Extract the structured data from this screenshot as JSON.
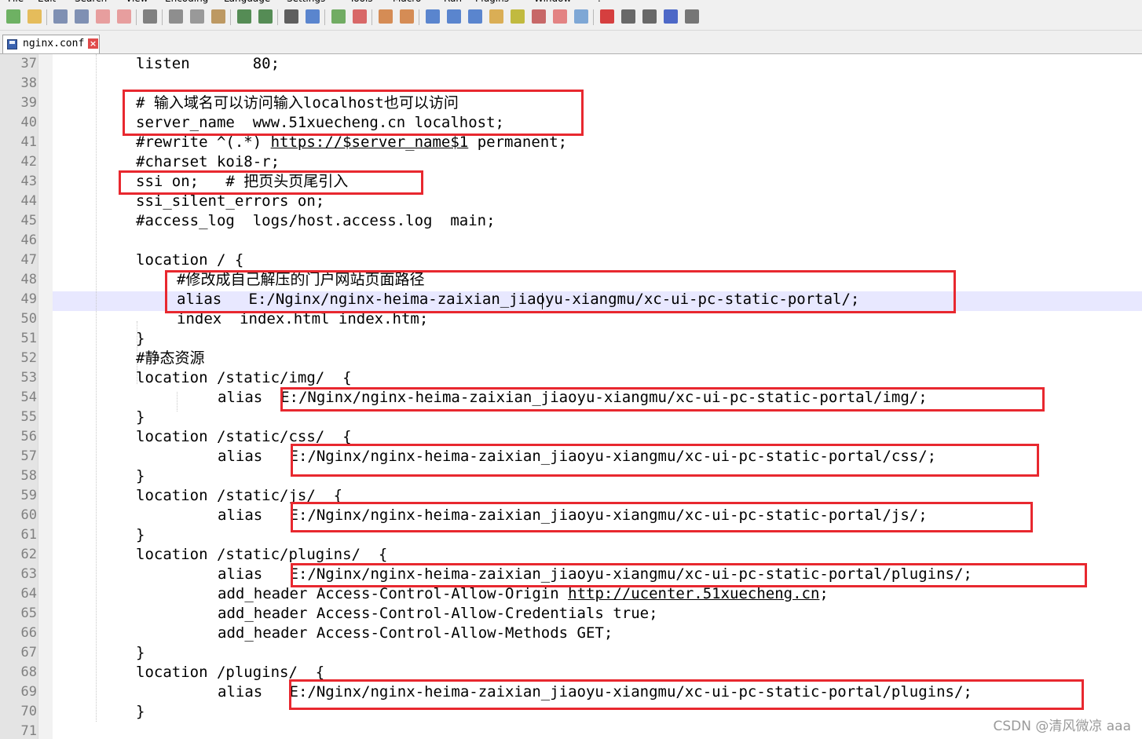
{
  "menu": [
    "File",
    "Edit",
    "Search",
    "View",
    "Encoding",
    "Language",
    "Settings",
    "Tools",
    "Macro",
    "Run",
    "Plugins",
    "Window",
    "?"
  ],
  "toolbar": {
    "buttons": [
      {
        "name": "new-file-icon",
        "color": "#57a64a"
      },
      {
        "name": "open-file-icon",
        "color": "#e3b341"
      },
      {
        "name": "save-icon",
        "color": "#6b7fa8"
      },
      {
        "name": "save-all-icon",
        "color": "#6b7fa8"
      },
      {
        "name": "close-icon",
        "color": "#e58f8f"
      },
      {
        "name": "close-all-icon",
        "color": "#e58f8f"
      },
      {
        "name": "print-icon",
        "color": "#6c6c6c"
      },
      {
        "name": "cut-icon",
        "color": "#7d7d7d"
      },
      {
        "name": "copy-icon",
        "color": "#8a8a8a"
      },
      {
        "name": "paste-icon",
        "color": "#b48a4a"
      },
      {
        "name": "undo-icon",
        "color": "#3a7a3a"
      },
      {
        "name": "redo-icon",
        "color": "#3a7a3a"
      },
      {
        "name": "find-icon",
        "color": "#444444"
      },
      {
        "name": "replace-icon",
        "color": "#3f72c8"
      },
      {
        "name": "zoom-in-icon",
        "color": "#5aa04a"
      },
      {
        "name": "zoom-out-icon",
        "color": "#d35050"
      },
      {
        "name": "sync-vertical-icon",
        "color": "#d07a3a"
      },
      {
        "name": "sync-horizontal-icon",
        "color": "#d07a3a"
      },
      {
        "name": "word-wrap-icon",
        "color": "#3f72c8"
      },
      {
        "name": "show-all-chars-icon",
        "color": "#3f72c8"
      },
      {
        "name": "indent-guide-icon",
        "color": "#3f72c8"
      },
      {
        "name": "language-icon",
        "color": "#d6a23a"
      },
      {
        "name": "doc-map-icon",
        "color": "#b8b020"
      },
      {
        "name": "function-list-icon",
        "color": "#c05050"
      },
      {
        "name": "folder-as-workspace-icon",
        "color": "#e07070"
      },
      {
        "name": "monitoring-icon",
        "color": "#6a9ad0"
      },
      {
        "name": "record-macro-icon",
        "color": "#d02020"
      },
      {
        "name": "stop-macro-icon",
        "color": "#505050"
      },
      {
        "name": "play-macro-icon",
        "color": "#505050"
      },
      {
        "name": "run-macro-multiple-icon",
        "color": "#3050c0"
      },
      {
        "name": "save-macro-icon",
        "color": "#606060"
      }
    ]
  },
  "tab": {
    "label": "nginx.conf"
  },
  "editor": {
    "highlight_line": 49,
    "lines": [
      {
        "n": "37",
        "text": "listen       80;",
        "indent": 1
      },
      {
        "n": "38",
        "text": "",
        "indent": 1
      },
      {
        "n": "39",
        "text": "# 输入域名可以访问输入localhost也可以访问",
        "indent": 1
      },
      {
        "n": "40",
        "text": "server_name  www.51xuecheng.cn localhost;",
        "indent": 1
      },
      {
        "n": "41",
        "pre": "#rewrite ^(.*) ",
        "link": "https://$server_name$1",
        "post": " permanent;",
        "indent": 1
      },
      {
        "n": "42",
        "text": "#charset koi8-r;",
        "indent": 1
      },
      {
        "n": "43",
        "text": "ssi on;   # 把页头页尾引入",
        "indent": 1
      },
      {
        "n": "44",
        "text": "ssi_silent_errors on;",
        "indent": 1
      },
      {
        "n": "45",
        "text": "#access_log  logs/host.access.log  main;",
        "indent": 1
      },
      {
        "n": "46",
        "text": "",
        "indent": 1
      },
      {
        "n": "47",
        "text": "location / {",
        "indent": 1
      },
      {
        "n": "48",
        "text": "#修改成自己解压的门户网站页面路径",
        "indent": 2
      },
      {
        "n": "49",
        "text": "alias   E:/Nginx/nginx-heima-zaixian_jiaoyu-xiangmu/xc-ui-pc-static-portal/;",
        "indent": 2
      },
      {
        "n": "50",
        "text": "index  index.html index.htm;",
        "indent": 2
      },
      {
        "n": "51",
        "text": "}",
        "indent": 1
      },
      {
        "n": "52",
        "text": "#静态资源",
        "indent": 1
      },
      {
        "n": "53",
        "text": "location /static/img/  {",
        "indent": 1
      },
      {
        "n": "54",
        "text": "alias  E:/Nginx/nginx-heima-zaixian_jiaoyu-xiangmu/xc-ui-pc-static-portal/img/;",
        "indent": 3
      },
      {
        "n": "55",
        "text": "}",
        "indent": 1
      },
      {
        "n": "56",
        "text": "location /static/css/  {",
        "indent": 1
      },
      {
        "n": "57",
        "text": "alias   E:/Nginx/nginx-heima-zaixian_jiaoyu-xiangmu/xc-ui-pc-static-portal/css/;",
        "indent": 3
      },
      {
        "n": "58",
        "text": "}",
        "indent": 1
      },
      {
        "n": "59",
        "text": "location /static/js/  {",
        "indent": 1
      },
      {
        "n": "60",
        "text": "alias   E:/Nginx/nginx-heima-zaixian_jiaoyu-xiangmu/xc-ui-pc-static-portal/js/;",
        "indent": 3
      },
      {
        "n": "61",
        "text": "}",
        "indent": 1
      },
      {
        "n": "62",
        "text": "location /static/plugins/  {",
        "indent": 1
      },
      {
        "n": "63",
        "text": "alias   E:/Nginx/nginx-heima-zaixian_jiaoyu-xiangmu/xc-ui-pc-static-portal/plugins/;",
        "indent": 3
      },
      {
        "n": "64",
        "pre": "add_header Access-Control-Allow-Origin ",
        "link": "http://ucenter.51xuecheng.cn",
        "post": ";",
        "indent": 3
      },
      {
        "n": "65",
        "text": "add_header Access-Control-Allow-Credentials true;",
        "indent": 3
      },
      {
        "n": "66",
        "text": "add_header Access-Control-Allow-Methods GET;",
        "indent": 3
      },
      {
        "n": "67",
        "text": "}",
        "indent": 1
      },
      {
        "n": "68",
        "text": "location /plugins/  {",
        "indent": 1
      },
      {
        "n": "69",
        "text": "alias   E:/Nginx/nginx-heima-zaixian_jiaoyu-xiangmu/xc-ui-pc-static-portal/plugins/;",
        "indent": 3
      },
      {
        "n": "70",
        "text": "}",
        "indent": 1
      },
      {
        "n": "71",
        "text": "",
        "indent": 1
      }
    ]
  },
  "annotation_color": "#e8282f",
  "watermark": "CSDN @清风微凉 aaa"
}
